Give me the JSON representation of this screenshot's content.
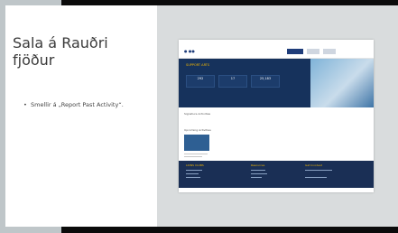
{
  "slide": {
    "title": "Sala á Rauðri fjöður",
    "bullets": [
      "Smellir á „Report Past Activity“."
    ]
  },
  "screenshot": {
    "logo_text": "● ●●",
    "hero_title": "SUPPORT ARTS",
    "stats": [
      "292",
      "17",
      "25,183"
    ],
    "section_heading_1": "Signature Activities",
    "section_heading_2": "Upcoming Activities",
    "footer_heads": [
      "LIONS CLUBS",
      "Resources",
      "Get Involved"
    ]
  },
  "colors": {
    "brand_navy": "#16325c",
    "brand_gold": "#f2b600",
    "frame_dark": "#0b0b0b",
    "surround_gray": "#bfc6c9"
  }
}
